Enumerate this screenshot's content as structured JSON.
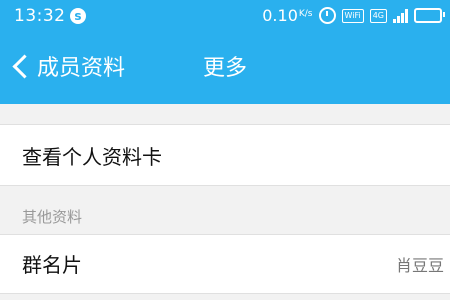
{
  "status_bar": {
    "time": "13:32",
    "notification_icon": "s",
    "net_speed": "0.10",
    "net_unit": "K/s",
    "wifi_label": "WiFi",
    "signal_label": "4G",
    "icons": [
      "alarm-icon",
      "wifi-icon",
      "signal-icon",
      "battery-icon"
    ]
  },
  "nav": {
    "back_label": "成员资料",
    "title": "更多"
  },
  "rows": {
    "view_card": {
      "label": "查看个人资料卡"
    },
    "section_title": "其他资料",
    "group_card": {
      "label": "群名片",
      "value": "肖豆豆"
    }
  },
  "colors": {
    "header": "#2ab0ee",
    "background": "#f2f2f2"
  }
}
